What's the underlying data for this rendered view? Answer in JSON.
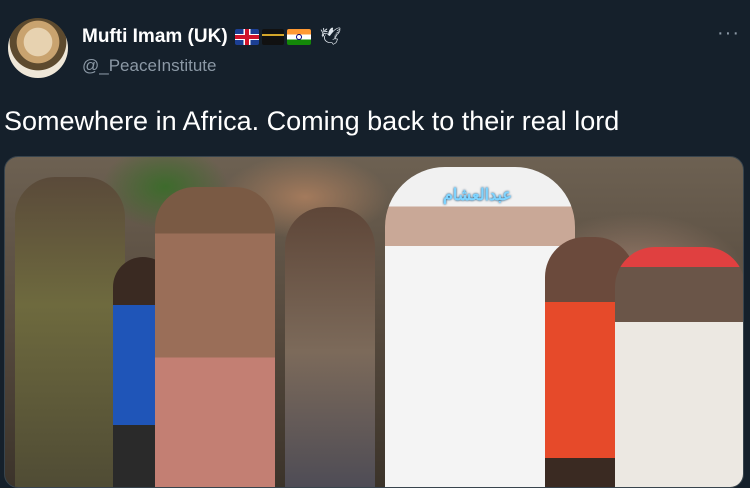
{
  "author": {
    "display_name": "Mufti Imam (UK)",
    "handle": "@_PeaceInstitute",
    "name_emoji": [
      "uk-flag",
      "kaaba",
      "india-flag",
      "dove"
    ]
  },
  "tweet": {
    "text": "Somewhere in Africa.  Coming back to their real lord"
  },
  "menu": {
    "more_label": "···"
  },
  "media": {
    "overlay_text": "عبدالعشام"
  }
}
